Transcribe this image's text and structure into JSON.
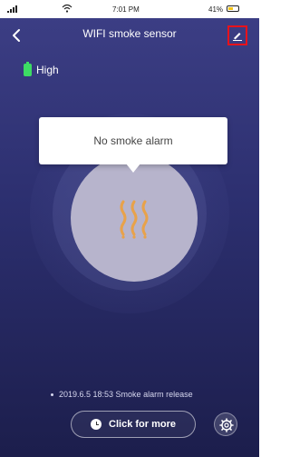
{
  "status_bar": {
    "signal_icon": "signal-icon",
    "wifi_icon": "wifi-icon",
    "time": "7:01 PM",
    "battery_text": "41%",
    "battery_icon": "battery-icon"
  },
  "header": {
    "back_icon": "chevron-left-icon",
    "title": "WIFI smoke sensor",
    "edit_icon": "pencil-icon"
  },
  "device": {
    "battery_level_label": "High",
    "battery_icon": "battery-icon",
    "alarm_message": "No smoke alarm",
    "smoke_icon": "smoke-icon"
  },
  "log": {
    "entry": "2019.6.5 18:53 Smoke alarm release"
  },
  "actions": {
    "more_label": "Click for more",
    "more_icon": "clock-icon",
    "settings_icon": "gear-icon"
  },
  "colors": {
    "background_top": "#3d3f86",
    "background_bottom": "#1c1e4c",
    "battery_green": "#3ddc64",
    "smoke_orange": "#e8a24a",
    "highlight_red": "#e8121b",
    "circle": "#b7b4cc"
  }
}
